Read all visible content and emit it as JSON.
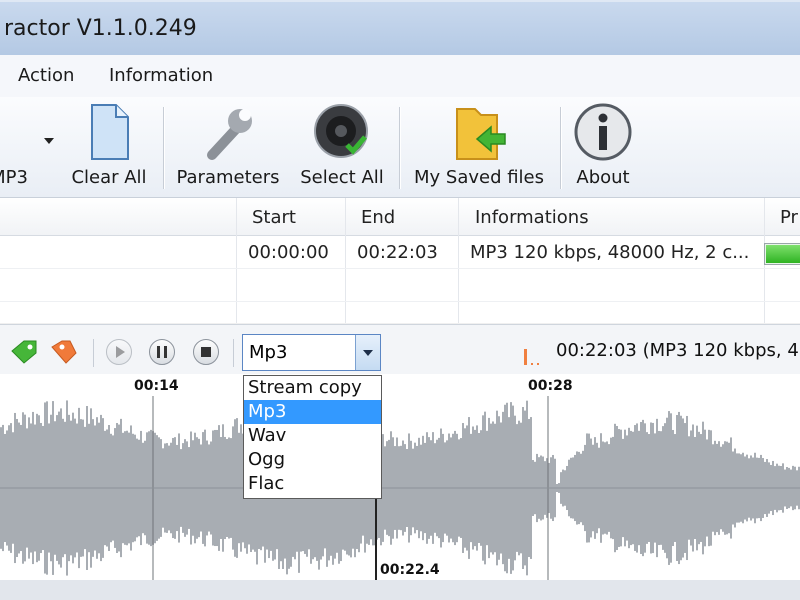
{
  "window": {
    "title": "ractor V1.1.0.249"
  },
  "menu": {
    "items": [
      "Action",
      "Information"
    ]
  },
  "toolbar": {
    "mp3_label": "MP3",
    "clear_all": "Clear All",
    "parameters": "Parameters",
    "select_all": "Select All",
    "saved_files": "My Saved files",
    "about": "About"
  },
  "table": {
    "headers": {
      "start": "Start",
      "end": "End",
      "info": "Informations",
      "progress": "Pr"
    },
    "rows": [
      {
        "start": "00:00:00",
        "end": "00:22:03",
        "info": "MP3 120 kbps, 48000 Hz, 2 c...",
        "progress": 1.0
      }
    ]
  },
  "player": {
    "format_selected": "Mp3",
    "options": [
      "Stream copy",
      "Mp3",
      "Wav",
      "Ogg",
      "Flac"
    ],
    "info": "00:22:03 (MP3 120 kbps, 4"
  },
  "timeline": {
    "ticks": [
      "00:14",
      "00:28"
    ],
    "cursor_time": "00:22.4"
  },
  "colors": {
    "accent": "#3399ff",
    "waveform": "#a8adb3",
    "progress": "#2fb323"
  }
}
